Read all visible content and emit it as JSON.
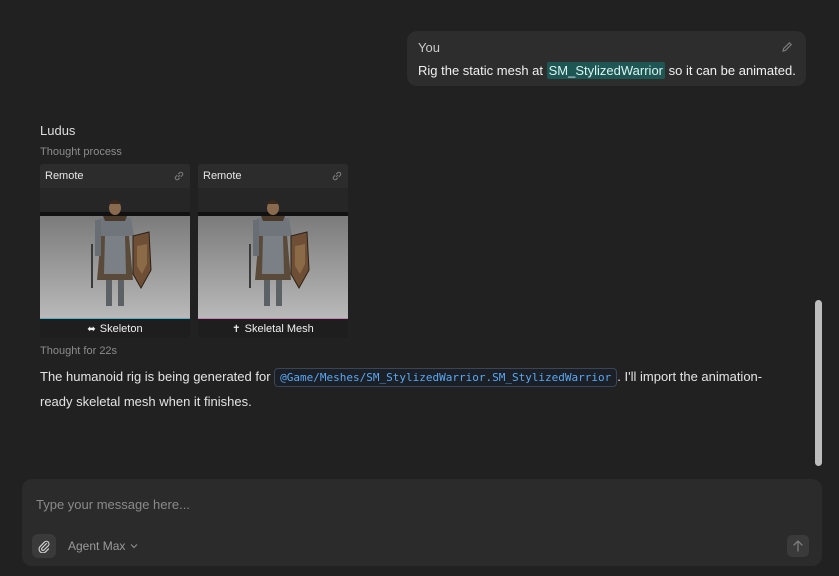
{
  "user_message": {
    "author": "You",
    "text_before": "Rig the static mesh at ",
    "asset": "SM_StylizedWarrior",
    "text_after": " so it can be animated."
  },
  "assistant": {
    "name": "Ludus",
    "thought_label": "Thought process",
    "cards": [
      {
        "source": "Remote",
        "caption": "Skeleton",
        "icon": "bone-icon"
      },
      {
        "source": "Remote",
        "caption": "Skeletal Mesh",
        "icon": "figure-icon"
      }
    ],
    "thought_time": "Thought for 22s",
    "response_before": "The humanoid rig is being generated for ",
    "response_path": "@Game/Meshes/SM_StylizedWarrior.SM_StylizedWarrior",
    "response_after": ". I'll import the animation-ready skeletal mesh when it finishes."
  },
  "composer": {
    "placeholder": "Type your message here...",
    "agent_label": "Agent Max"
  },
  "colors": {
    "background": "#212121",
    "asset_highlight": "#1e5654",
    "path_link": "#5aa8f5",
    "skeleton_accent": "#4fb3c9",
    "skeletal_mesh_accent": "#c77fb6"
  }
}
